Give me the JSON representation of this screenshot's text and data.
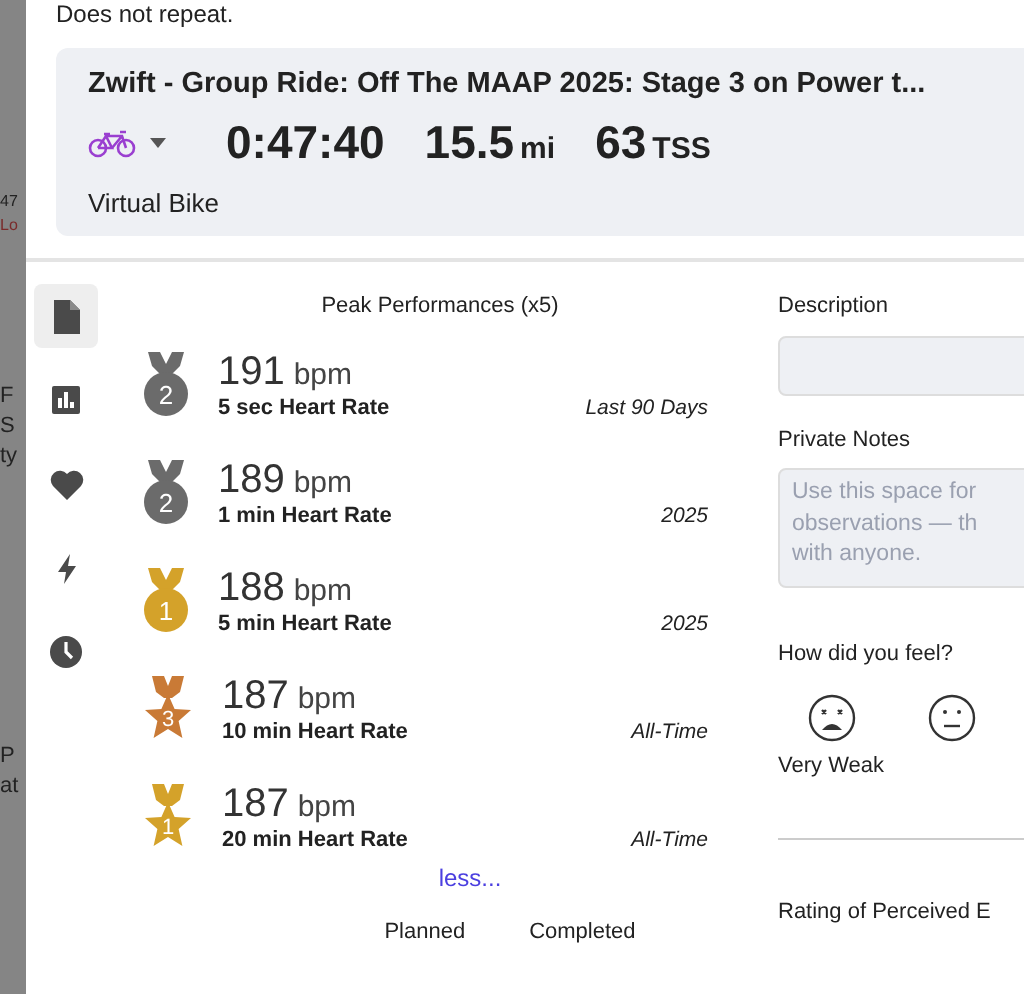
{
  "background_fragments": [
    {
      "text": "47"
    },
    {
      "text": "Lo"
    },
    {
      "text": "F"
    },
    {
      "text": "S"
    },
    {
      "text": "ty"
    },
    {
      "text": "P"
    },
    {
      "text": "at"
    }
  ],
  "repeat_text": "Does not repeat.",
  "workout": {
    "title": "Zwift - Group Ride: Off The MAAP 2025: Stage 3 on Power t...",
    "duration": "0:47:40",
    "distance": "15.5",
    "distance_unit": "mi",
    "tss": "63",
    "tss_unit": "TSS",
    "sport": "Virtual Bike"
  },
  "side_tabs": [
    {
      "kind": "document",
      "selected": true
    },
    {
      "kind": "chart",
      "selected": false
    },
    {
      "kind": "heart",
      "selected": false
    },
    {
      "kind": "bolt",
      "selected": false
    },
    {
      "kind": "clock",
      "selected": false
    }
  ],
  "peak_performances": {
    "title": "Peak Performances (x5)",
    "items": [
      {
        "kind": "medal",
        "rank": "2",
        "color": "#6b6b6b",
        "value": "191",
        "unit": "bpm",
        "label": "5 sec Heart Rate",
        "period": "Last 90 Days"
      },
      {
        "kind": "medal",
        "rank": "2",
        "color": "#6b6b6b",
        "value": "189",
        "unit": "bpm",
        "label": "1 min Heart Rate",
        "period": "2025"
      },
      {
        "kind": "medal",
        "rank": "1",
        "color": "#d4a22a",
        "value": "188",
        "unit": "bpm",
        "label": "5 min Heart Rate",
        "period": "2025"
      },
      {
        "kind": "star",
        "rank": "3",
        "color": "#c97a36",
        "value": "187",
        "unit": "bpm",
        "label": "10 min Heart Rate",
        "period": "All-Time"
      },
      {
        "kind": "star",
        "rank": "1",
        "color": "#d4a22a",
        "value": "187",
        "unit": "bpm",
        "label": "20 min Heart Rate",
        "period": "All-Time"
      }
    ],
    "toggle_link": "less...",
    "columns": [
      "Planned",
      "Completed"
    ]
  },
  "description": {
    "label": "Description"
  },
  "private_notes": {
    "label": "Private Notes",
    "placeholder": "Use this space for\nobservations — th\nwith anyone."
  },
  "feel": {
    "label": "How did you feel?",
    "options": [
      {
        "kind": "very-weak",
        "label": "Very Weak"
      },
      {
        "kind": "weak"
      }
    ]
  },
  "rpe": {
    "label": "Rating of Perceived E"
  }
}
